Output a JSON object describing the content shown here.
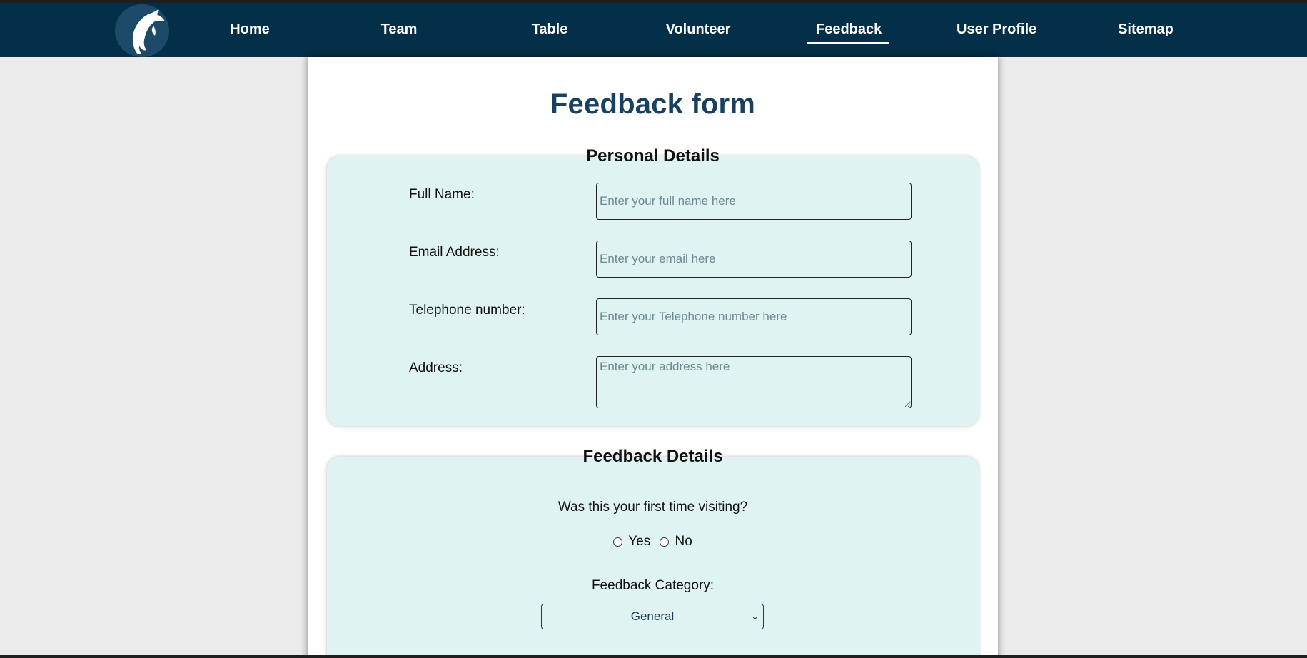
{
  "nav": {
    "items": [
      {
        "label": "Home",
        "active": false
      },
      {
        "label": "Team",
        "active": false
      },
      {
        "label": "Table",
        "active": false
      },
      {
        "label": "Volunteer",
        "active": false
      },
      {
        "label": "Feedback",
        "active": true
      },
      {
        "label": "User Profile",
        "active": false
      },
      {
        "label": "Sitemap",
        "active": false
      }
    ],
    "logo_icon": "dolphin-icon",
    "background": "#032f48"
  },
  "page": {
    "title": "Feedback form",
    "title_color": "#18415f",
    "fieldset_background": "#e0f3f3"
  },
  "personal": {
    "legend": "Personal Details",
    "full_name": {
      "label": "Full Name:",
      "placeholder": "Enter your full name here",
      "value": ""
    },
    "email": {
      "label": "Email Address:",
      "placeholder": "Enter your email here",
      "value": ""
    },
    "telephone": {
      "label": "Telephone number:",
      "placeholder": "Enter your Telephone number here",
      "value": ""
    },
    "address": {
      "label": "Address:",
      "placeholder": "Enter your address here",
      "value": ""
    }
  },
  "feedback": {
    "legend": "Feedback Details",
    "first_visit_question": "Was this your first time visiting?",
    "first_visit_options": [
      "Yes",
      "No"
    ],
    "category_label": "Feedback Category:",
    "category_selected": "General"
  }
}
